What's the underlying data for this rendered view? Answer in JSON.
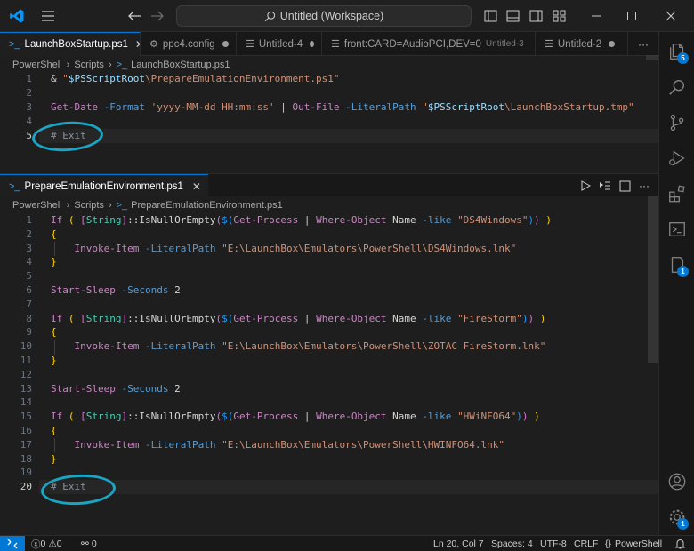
{
  "titlebar": {
    "search_text": "Untitled (Workspace)",
    "icons": [
      "vscode-logo-icon",
      "menu-icon",
      "back-arrow-icon",
      "forward-arrow-icon",
      "search-icon",
      "toggle-primary-sidebar-icon",
      "toggle-panel-icon",
      "toggle-secondary-sidebar-icon",
      "customize-layout-icon",
      "minimize-icon",
      "maximize-icon",
      "close-icon"
    ]
  },
  "tabs": [
    {
      "label": "LaunchBoxStartup.ps1",
      "active": true,
      "icon": "powershell-icon"
    },
    {
      "label": "ppc4.config",
      "icon": "gear-icon",
      "dirty": true
    },
    {
      "label": "Untitled-4",
      "icon": "file-icon",
      "dirty": true
    },
    {
      "label": "front:CARD=AudioPCI,DEV=0",
      "desc": "Untitled-3",
      "icon": "file-icon",
      "dirty": true
    },
    {
      "label": "Untitled-2",
      "icon": "file-icon",
      "dirty": true
    }
  ],
  "pane1": {
    "breadcrumb": [
      "PowerShell",
      "Scripts",
      "LaunchBoxStartup.ps1"
    ],
    "lines": [
      {
        "n": "1",
        "tokens": [
          [
            "& ",
            "op"
          ],
          [
            "\"",
            "str"
          ],
          [
            "$PSScriptRoot",
            "var"
          ],
          [
            "\\PrepareEmulationEnvironment.ps1\"",
            "str"
          ]
        ]
      },
      {
        "n": "2",
        "tokens": []
      },
      {
        "n": "3",
        "tokens": [
          [
            "Get-Date",
            "cmd"
          ],
          [
            " ",
            "plain"
          ],
          [
            "-Format",
            "par"
          ],
          [
            " ",
            "plain"
          ],
          [
            "'yyyy-MM-dd HH:mm:ss'",
            "str"
          ],
          [
            " | ",
            "op"
          ],
          [
            "Out-File",
            "cmd"
          ],
          [
            " ",
            "plain"
          ],
          [
            "-LiteralPath",
            "par"
          ],
          [
            " ",
            "plain"
          ],
          [
            "\"",
            "str"
          ],
          [
            "$PSScriptRoot",
            "var"
          ],
          [
            "\\LaunchBoxStartup.tmp\"",
            "str"
          ]
        ]
      },
      {
        "n": "4",
        "tokens": []
      },
      {
        "n": "5",
        "tokens": [
          [
            "# Exit",
            "cmt"
          ]
        ],
        "current": true
      }
    ]
  },
  "pane2": {
    "tab_label": "PrepareEmulationEnvironment.ps1",
    "breadcrumb": [
      "PowerShell",
      "Scripts",
      "PrepareEmulationEnvironment.ps1"
    ],
    "lines": [
      {
        "n": "1",
        "tokens": [
          [
            "If",
            "kw"
          ],
          [
            " ",
            "plain"
          ],
          [
            "(",
            "yel"
          ],
          [
            " ",
            "plain"
          ],
          [
            "[",
            "pur"
          ],
          [
            "String",
            "type"
          ],
          [
            "]",
            "pur"
          ],
          [
            "::IsNullOrEmpty",
            "plain"
          ],
          [
            "(",
            "pur"
          ],
          [
            "$(",
            "blu"
          ],
          [
            "Get-Process",
            "cmd"
          ],
          [
            " | ",
            "op"
          ],
          [
            "Where-Object",
            "cmd"
          ],
          [
            " Name ",
            "plain"
          ],
          [
            "-like",
            "par"
          ],
          [
            " ",
            "plain"
          ],
          [
            "\"DS4Windows\"",
            "str"
          ],
          [
            ")",
            "blu"
          ],
          [
            ")",
            "pur"
          ],
          [
            " ",
            "plain"
          ],
          [
            ")",
            "yel"
          ]
        ]
      },
      {
        "n": "2",
        "tokens": [
          [
            "{",
            "yel"
          ]
        ]
      },
      {
        "n": "3",
        "tokens": [
          [
            "    ",
            "plain"
          ],
          [
            "Invoke-Item",
            "cmd"
          ],
          [
            " ",
            "plain"
          ],
          [
            "-LiteralPath",
            "par"
          ],
          [
            " ",
            "plain"
          ],
          [
            "\"E:\\LaunchBox\\Emulators\\PowerShell\\DS4Windows.lnk\"",
            "str"
          ]
        ]
      },
      {
        "n": "4",
        "tokens": [
          [
            "}",
            "yel"
          ]
        ]
      },
      {
        "n": "5",
        "tokens": []
      },
      {
        "n": "6",
        "tokens": [
          [
            "Start-Sleep",
            "cmd"
          ],
          [
            " ",
            "plain"
          ],
          [
            "-Seconds",
            "par"
          ],
          [
            " 2",
            "plain"
          ]
        ]
      },
      {
        "n": "7",
        "tokens": []
      },
      {
        "n": "8",
        "tokens": [
          [
            "If",
            "kw"
          ],
          [
            " ",
            "plain"
          ],
          [
            "(",
            "yel"
          ],
          [
            " ",
            "plain"
          ],
          [
            "[",
            "pur"
          ],
          [
            "String",
            "type"
          ],
          [
            "]",
            "pur"
          ],
          [
            "::IsNullOrEmpty",
            "plain"
          ],
          [
            "(",
            "pur"
          ],
          [
            "$(",
            "blu"
          ],
          [
            "Get-Process",
            "cmd"
          ],
          [
            " | ",
            "op"
          ],
          [
            "Where-Object",
            "cmd"
          ],
          [
            " Name ",
            "plain"
          ],
          [
            "-like",
            "par"
          ],
          [
            " ",
            "plain"
          ],
          [
            "\"FireStorm\"",
            "str"
          ],
          [
            ")",
            "blu"
          ],
          [
            ")",
            "pur"
          ],
          [
            " ",
            "plain"
          ],
          [
            ")",
            "yel"
          ]
        ]
      },
      {
        "n": "9",
        "tokens": [
          [
            "{",
            "yel"
          ]
        ]
      },
      {
        "n": "10",
        "tokens": [
          [
            "    ",
            "plain"
          ],
          [
            "Invoke-Item",
            "cmd"
          ],
          [
            " ",
            "plain"
          ],
          [
            "-LiteralPath",
            "par"
          ],
          [
            " ",
            "plain"
          ],
          [
            "\"E:\\LaunchBox\\Emulators\\PowerShell\\ZOTAC FireStorm.lnk\"",
            "str"
          ]
        ]
      },
      {
        "n": "11",
        "tokens": [
          [
            "}",
            "yel"
          ]
        ]
      },
      {
        "n": "12",
        "tokens": []
      },
      {
        "n": "13",
        "tokens": [
          [
            "Start-Sleep",
            "cmd"
          ],
          [
            " ",
            "plain"
          ],
          [
            "-Seconds",
            "par"
          ],
          [
            " 2",
            "plain"
          ]
        ]
      },
      {
        "n": "14",
        "tokens": []
      },
      {
        "n": "15",
        "tokens": [
          [
            "If",
            "kw"
          ],
          [
            " ",
            "plain"
          ],
          [
            "(",
            "yel"
          ],
          [
            " ",
            "plain"
          ],
          [
            "[",
            "pur"
          ],
          [
            "String",
            "type"
          ],
          [
            "]",
            "pur"
          ],
          [
            "::IsNullOrEmpty",
            "plain"
          ],
          [
            "(",
            "pur"
          ],
          [
            "$(",
            "blu"
          ],
          [
            "Get-Process",
            "cmd"
          ],
          [
            " | ",
            "op"
          ],
          [
            "Where-Object",
            "cmd"
          ],
          [
            " Name ",
            "plain"
          ],
          [
            "-like",
            "par"
          ],
          [
            " ",
            "plain"
          ],
          [
            "\"HWiNFO64\"",
            "str"
          ],
          [
            ")",
            "blu"
          ],
          [
            ")",
            "pur"
          ],
          [
            " ",
            "plain"
          ],
          [
            ")",
            "yel"
          ]
        ]
      },
      {
        "n": "16",
        "tokens": [
          [
            "{",
            "yel"
          ]
        ]
      },
      {
        "n": "17",
        "tokens": [
          [
            "    ",
            "plain"
          ],
          [
            "Invoke-Item",
            "cmd"
          ],
          [
            " ",
            "plain"
          ],
          [
            "-LiteralPath",
            "par"
          ],
          [
            " ",
            "plain"
          ],
          [
            "\"E:\\LaunchBox\\Emulators\\PowerShell\\HWINFO64.lnk\"",
            "str"
          ]
        ]
      },
      {
        "n": "18",
        "tokens": [
          [
            "}",
            "yel"
          ]
        ]
      },
      {
        "n": "19",
        "tokens": []
      },
      {
        "n": "20",
        "tokens": [
          [
            "# Exit",
            "cmt"
          ]
        ],
        "current": true
      }
    ]
  },
  "activitybar": {
    "items": [
      {
        "name": "explorer-icon",
        "badge": "5"
      },
      {
        "name": "search-icon"
      },
      {
        "name": "source-control-icon"
      },
      {
        "name": "run-debug-icon"
      },
      {
        "name": "extensions-icon"
      },
      {
        "name": "powershell-terminal-icon"
      },
      {
        "name": "pull-request-icon",
        "badge": "1"
      },
      {
        "name": "accounts-icon"
      },
      {
        "name": "manage-gear-icon",
        "badge": "1"
      }
    ]
  },
  "statusbar": {
    "problems_errors": "0",
    "problems_warnings": "0",
    "ports": "0",
    "cursor_position": "Ln 20, Col 7",
    "indentation": "Spaces: 4",
    "encoding": "UTF-8",
    "eol": "CRLF",
    "language": "PowerShell"
  },
  "colors": {
    "accent": "#0078d4",
    "annotation": "#1ba5c4"
  }
}
